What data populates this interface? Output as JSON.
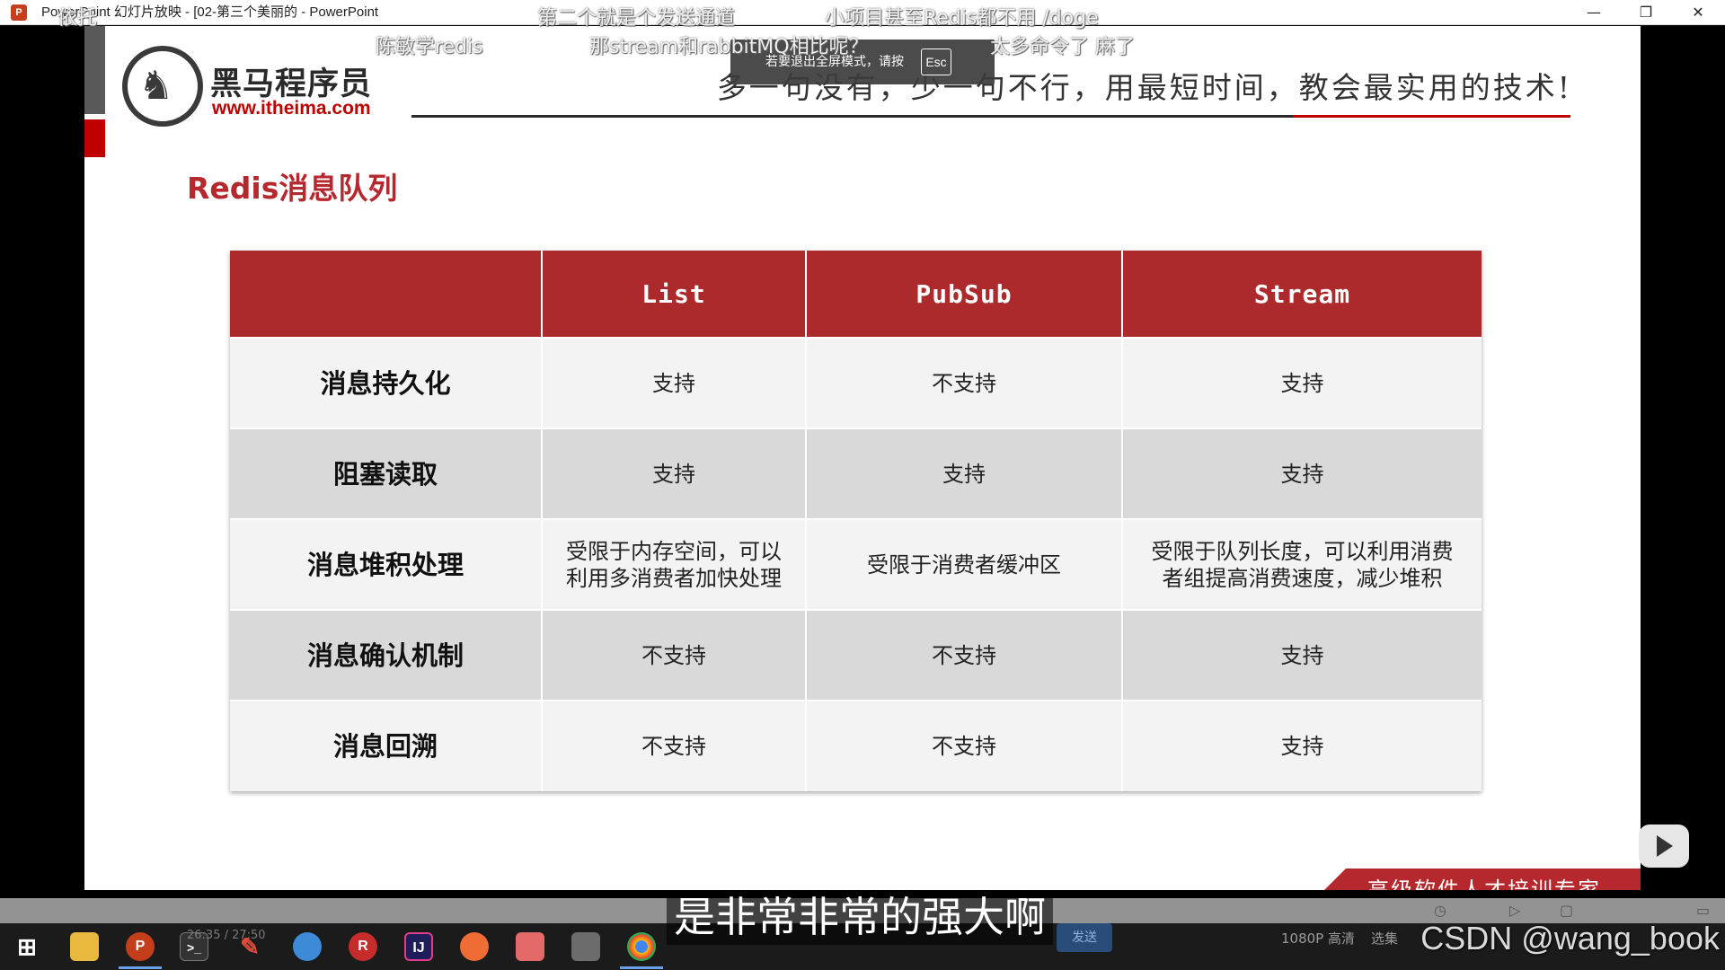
{
  "window": {
    "title": "PowerPoint 幻灯片放映 - [02-第三个美丽的 - PowerPoint",
    "icon": "P",
    "minimize": "—",
    "restore": "❐",
    "close": "✕"
  },
  "header": {
    "logo_name": "黑马程序员",
    "logo_url": "www.itheima.com",
    "slogan": "多一句没有，少一句不行，用最短时间，教会最实用的技术!"
  },
  "slide": {
    "title": "Redis消息队列",
    "tagline": "高级软件人才培训专家"
  },
  "table": {
    "columns": [
      "",
      "List",
      "PubSub",
      "Stream"
    ],
    "rows": [
      {
        "label": "消息持久化",
        "cells": [
          "支持",
          "不支持",
          "支持"
        ]
      },
      {
        "label": "阻塞读取",
        "cells": [
          "支持",
          "支持",
          "支持"
        ]
      },
      {
        "label": "消息堆积处理",
        "cells": [
          "受限于内存空间，可以利用多消费者加快处理",
          "受限于消费者缓冲区",
          "受限于队列长度，可以利用消费者组提高消费速度，减少堆积"
        ]
      },
      {
        "label": "消息确认机制",
        "cells": [
          "不支持",
          "不支持",
          "支持"
        ]
      },
      {
        "label": "消息回溯",
        "cells": [
          "不支持",
          "不支持",
          "支持"
        ]
      }
    ]
  },
  "overlay": {
    "esc_tip": "若要退出全屏模式，请按",
    "esc_key": "Esc",
    "danmaku": [
      "依托",
      "第二个就是个发送通道",
      "小项目甚至Redis都不用 /doge",
      "陈敏学redis",
      "那stream和rabbitMQ相比呢？",
      "太多命令了 麻了"
    ],
    "subtitle": "是非常非常的强大啊",
    "watermark": "CSDN @wang_book"
  },
  "player": {
    "time": "26:35 / 27:50",
    "send": "发送",
    "quality": "1080P 高清",
    "select": "选集"
  },
  "taskbar": {
    "icons": [
      "windows-start",
      "file-explorer",
      "powerpoint",
      "terminal",
      "pen",
      "sketch-app",
      "redis-desktop",
      "intellij-idea",
      "postman",
      "eraser-app",
      "screenshot-tool",
      "chrome"
    ],
    "accent": "#6aa0e8"
  },
  "colors": {
    "brand_red": "#ad2a2c",
    "title_red": "#b5282d",
    "row_light": "#f3f3f3",
    "row_dark": "#d9d9d9"
  }
}
